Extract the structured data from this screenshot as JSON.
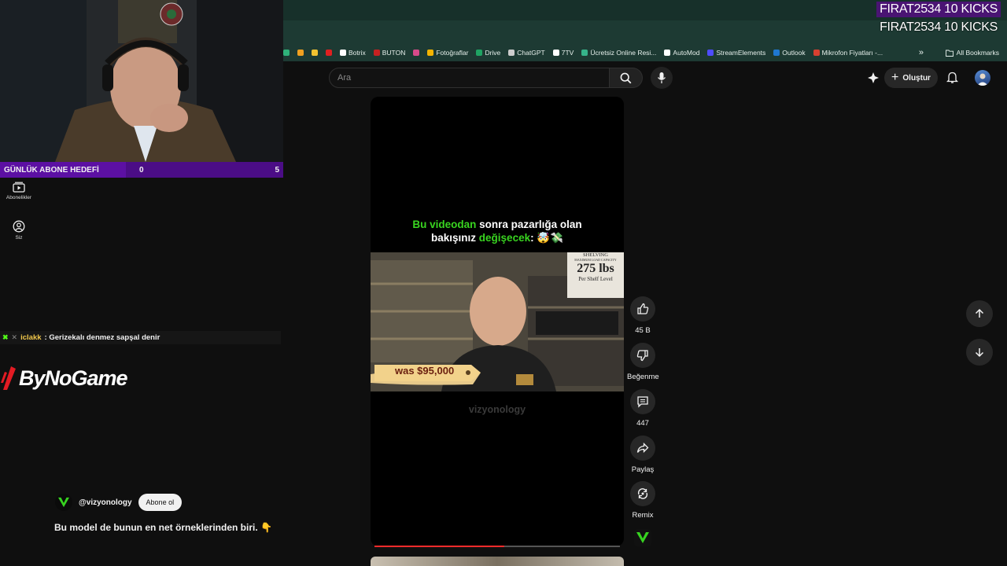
{
  "browser": {
    "bookmarks": [
      {
        "label": "",
        "color": "#2fb27a"
      },
      {
        "label": "",
        "color": "#f0a020"
      },
      {
        "label": "",
        "color": "#f2c230"
      },
      {
        "label": "",
        "color": "#e02020"
      },
      {
        "label": "Botrix",
        "color": "#ffffff"
      },
      {
        "label": "BUTON",
        "color": "#c62121"
      },
      {
        "label": "",
        "color": "#d84a8a"
      },
      {
        "label": "Fotoğraflar",
        "color": "#f4b400"
      },
      {
        "label": "Drive",
        "color": "#1fa463"
      },
      {
        "label": "ChatGPT",
        "color": "#cccccc"
      },
      {
        "label": "7TV",
        "color": "#ffffff"
      },
      {
        "label": "Ücretsiz Online Resi...",
        "color": "#36b38a"
      },
      {
        "label": "AutoMod",
        "color": "#ffffff"
      },
      {
        "label": "StreamElements",
        "color": "#4e4cff"
      },
      {
        "label": "Outlook",
        "color": "#1f78d1"
      },
      {
        "label": "Mikrofon Fiyatları -...",
        "color": "#d84030"
      }
    ],
    "more": "»",
    "all_bookmarks": "All Bookmarks"
  },
  "overlay": {
    "kick_line_1": "FIRAT2534  10 KICKS",
    "kick_line_2": "FIRAT2534  10 KICKS",
    "goal_label": "GÜNLÜK ABONE HEDEFİ",
    "goal_current": "0",
    "goal_target": "5",
    "chat_user": "iclakk",
    "chat_sep": ":",
    "chat_message": "Gerizekalı denmez sapşal denir",
    "brand_logo": "ByNoGame"
  },
  "sidebar": {
    "items": [
      {
        "label": "Abonelikler",
        "icon": "subscriptions-icon"
      },
      {
        "label": "Siz",
        "icon": "user-icon"
      }
    ]
  },
  "header": {
    "search_placeholder": "Ara",
    "create_label": "Oluştur"
  },
  "video": {
    "caption_green_1": "Bu videodan",
    "caption_white_1": " sonra pazarlığa olan",
    "caption_white_2": "bakışınız ",
    "caption_green_2": "değişecek",
    "caption_end": ": 🤯💸",
    "price_tag": "was $95,000",
    "sign_title": "SHELVING",
    "sign_sub": "MAXIMUM LOAD CAPACITY",
    "sign_weight": "275 lbs",
    "sign_level": "Per Shelf Level",
    "watermark": "vizyonology",
    "progress_fraction": 0.53
  },
  "actions": {
    "like_count": "45 B",
    "dislike_label": "Beğenme",
    "comment_count": "447",
    "share_label": "Paylaş",
    "remix_label": "Remix"
  },
  "channel": {
    "handle": "@vizyonology",
    "subscribe_label": "Abone ol",
    "description": "Bu model de bunun en net örneklerinden biri. 👇"
  }
}
